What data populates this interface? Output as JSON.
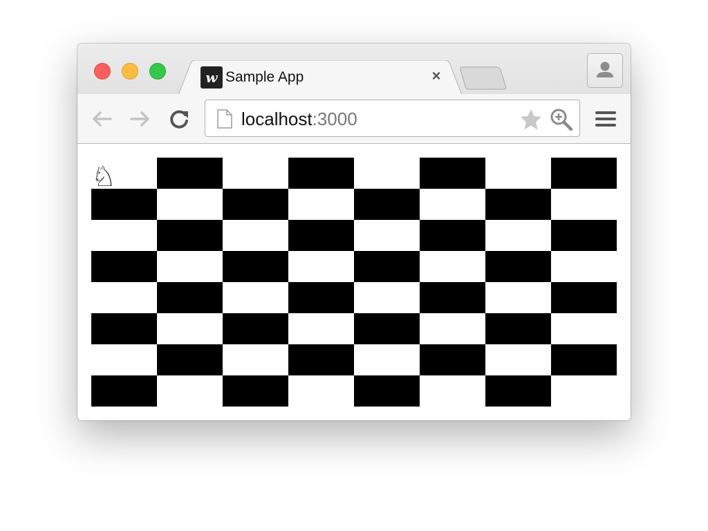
{
  "window": {
    "controls": [
      "close",
      "minimize",
      "zoom"
    ]
  },
  "tab": {
    "favicon_letter": "w",
    "title": "Sample App",
    "close_symbol": "×"
  },
  "toolbar": {
    "back_icon": "back-arrow-icon",
    "forward_icon": "forward-arrow-icon",
    "reload_icon": "reload-icon",
    "url_host": "localhost",
    "url_port": ":3000",
    "bookmark_icon": "star-icon",
    "zoom_icon": "zoom-in-icon",
    "menu_icon": "hamburger-menu-icon"
  },
  "board": {
    "rows": 8,
    "cols": 8,
    "dark_color": "#000000",
    "light_color": "#ffffff",
    "knight": {
      "symbol": "♘",
      "row": 0,
      "col": 0
    }
  }
}
